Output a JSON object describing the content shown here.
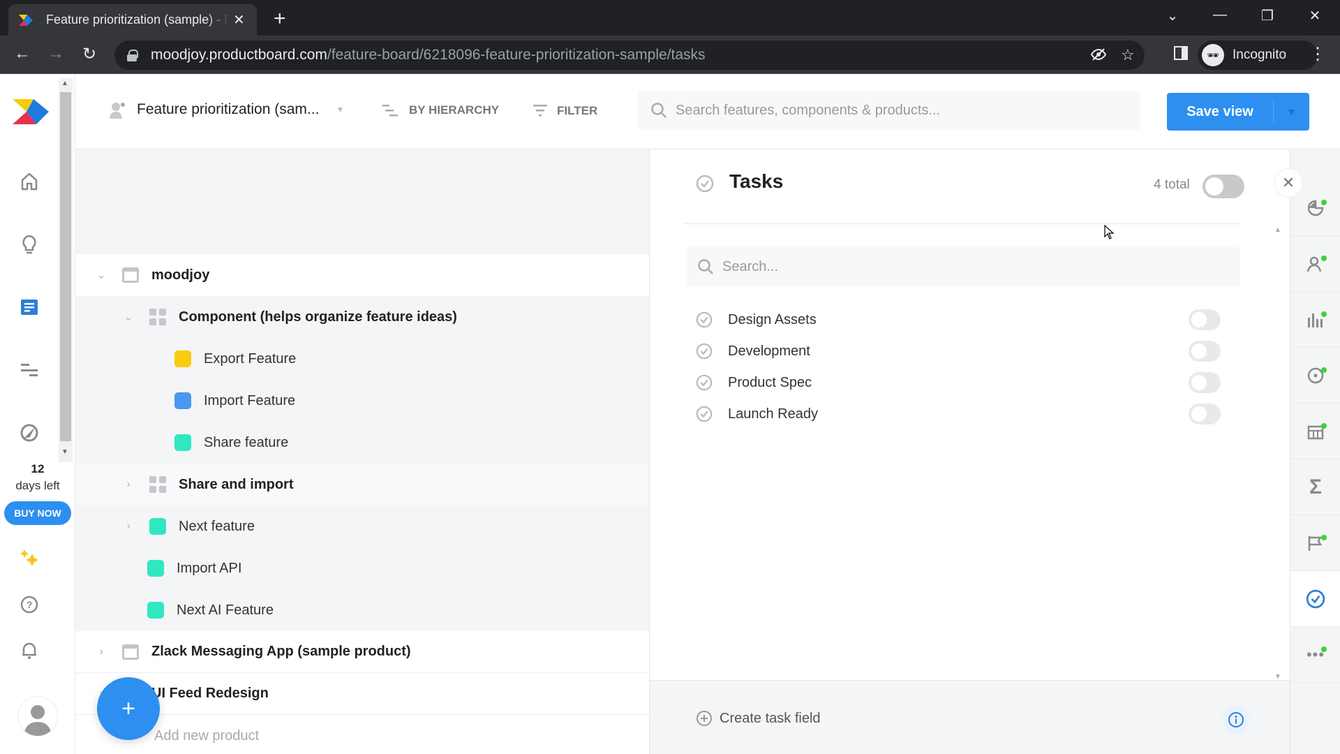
{
  "browser": {
    "tab_title": "Feature prioritization (sample) - Productboard",
    "url_host": "moodjoy.productboard.com",
    "url_path": "/feature-board/6218096-feature-prioritization-sample/tasks",
    "profile_label": "Incognito"
  },
  "header": {
    "board_name": "Feature prioritization (sam...",
    "group_by_label": "BY HIERARCHY",
    "filter_label": "FILTER",
    "search_placeholder": "Search features, components & products...",
    "save_view_label": "Save view"
  },
  "leftnav": {
    "items": [
      {
        "icon": "home-icon"
      },
      {
        "icon": "insights-lightbulb-icon"
      },
      {
        "icon": "features-board-icon",
        "active": true
      },
      {
        "icon": "roadmap-icon"
      },
      {
        "icon": "portal-icon"
      }
    ],
    "trial_days": "12",
    "trial_label": "days left",
    "buy_label": "BUY NOW"
  },
  "tree": {
    "rows": [
      {
        "level": 0,
        "type": "product",
        "label": "moodjoy",
        "expanded": true
      },
      {
        "level": 1,
        "type": "component",
        "label": "Component (helps organize feature ideas)",
        "expanded": true
      },
      {
        "level": 2,
        "type": "feature",
        "label": "Export Feature",
        "color": "#f8cc0f"
      },
      {
        "level": 2,
        "type": "feature",
        "label": "Import Feature",
        "color": "#4a98ef"
      },
      {
        "level": 2,
        "type": "feature",
        "label": "Share feature",
        "color": "#2fe8c2"
      },
      {
        "level": 1,
        "type": "component",
        "label": "Share and import",
        "expanded": false
      },
      {
        "level": 1,
        "type": "feature",
        "label": "Next feature",
        "color": "#2fe8c2",
        "expandable": true
      },
      {
        "level": 1,
        "type": "feature",
        "label": "Import API",
        "color": "#2fe8c2"
      },
      {
        "level": 1,
        "type": "feature",
        "label": "Next AI Feature",
        "color": "#2fe8c2"
      },
      {
        "level": 0,
        "type": "product",
        "label": "Zlack Messaging App (sample product)",
        "expanded": false
      },
      {
        "level": 0,
        "type": "product",
        "label": "UI Feed Redesign",
        "expanded": false
      }
    ],
    "add_product_label": "Add new product"
  },
  "tasks_panel": {
    "title": "Tasks",
    "total_label": "4 total",
    "search_placeholder": "Search...",
    "items": [
      {
        "label": "Design Assets",
        "enabled": false
      },
      {
        "label": "Development",
        "enabled": false
      },
      {
        "label": "Product Spec",
        "enabled": false
      },
      {
        "label": "Launch Ready",
        "enabled": false
      }
    ],
    "create_label": "Create task field"
  },
  "right_rail": {
    "items": [
      {
        "icon": "pie-chart-icon",
        "dot": true
      },
      {
        "icon": "user-impact-icon",
        "dot": true
      },
      {
        "icon": "bar-score-icon",
        "dot": true
      },
      {
        "icon": "target-icon",
        "dot": true
      },
      {
        "icon": "calendar-grid-icon",
        "dot": true
      },
      {
        "icon": "sigma-formula-icon",
        "dot": false
      },
      {
        "icon": "flag-icon",
        "dot": true
      },
      {
        "icon": "tasks-check-icon",
        "dot": false,
        "active": true
      },
      {
        "icon": "more-icon",
        "dot": true
      }
    ]
  },
  "colors": {
    "accent": "#2d8ff0",
    "status_dot": "#3ed13a"
  }
}
